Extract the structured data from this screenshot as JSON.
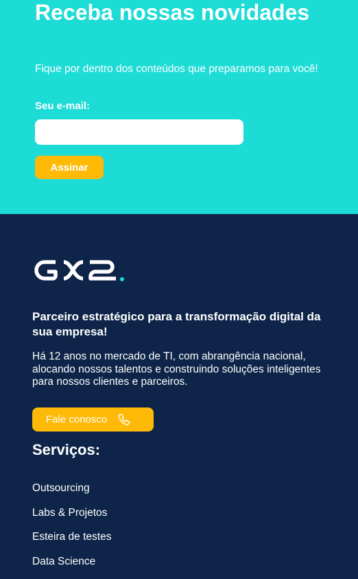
{
  "newsletter": {
    "title": "Receba nossas novidades",
    "subtitle": "Fique por dentro dos conteúdos que preparamos para você!",
    "email_label": "Seu e-mail:",
    "email_value": "",
    "submit_label": "Assinar",
    "background_color": "#1ddcd6",
    "button_color": "#ffba08"
  },
  "footer": {
    "logo_text": "GX2",
    "tagline": "Parceiro estratégico para a transformação digital da sua empresa!",
    "description": "Há 12 anos no mercado de TI, com abrangência nacional, alocando nossos talentos e construindo soluções inteligentes para nossos clientes e parceiros.",
    "contact_label": "Fale conosco",
    "contact_icon": "phone-icon",
    "services_title": "Serviços:",
    "services": [
      {
        "label": "Outsourcing"
      },
      {
        "label": "Labs & Projetos"
      },
      {
        "label": "Esteira de testes"
      },
      {
        "label": "Data Science"
      }
    ],
    "background_color": "#0e2549",
    "accent_color": "#1ddcd6"
  }
}
